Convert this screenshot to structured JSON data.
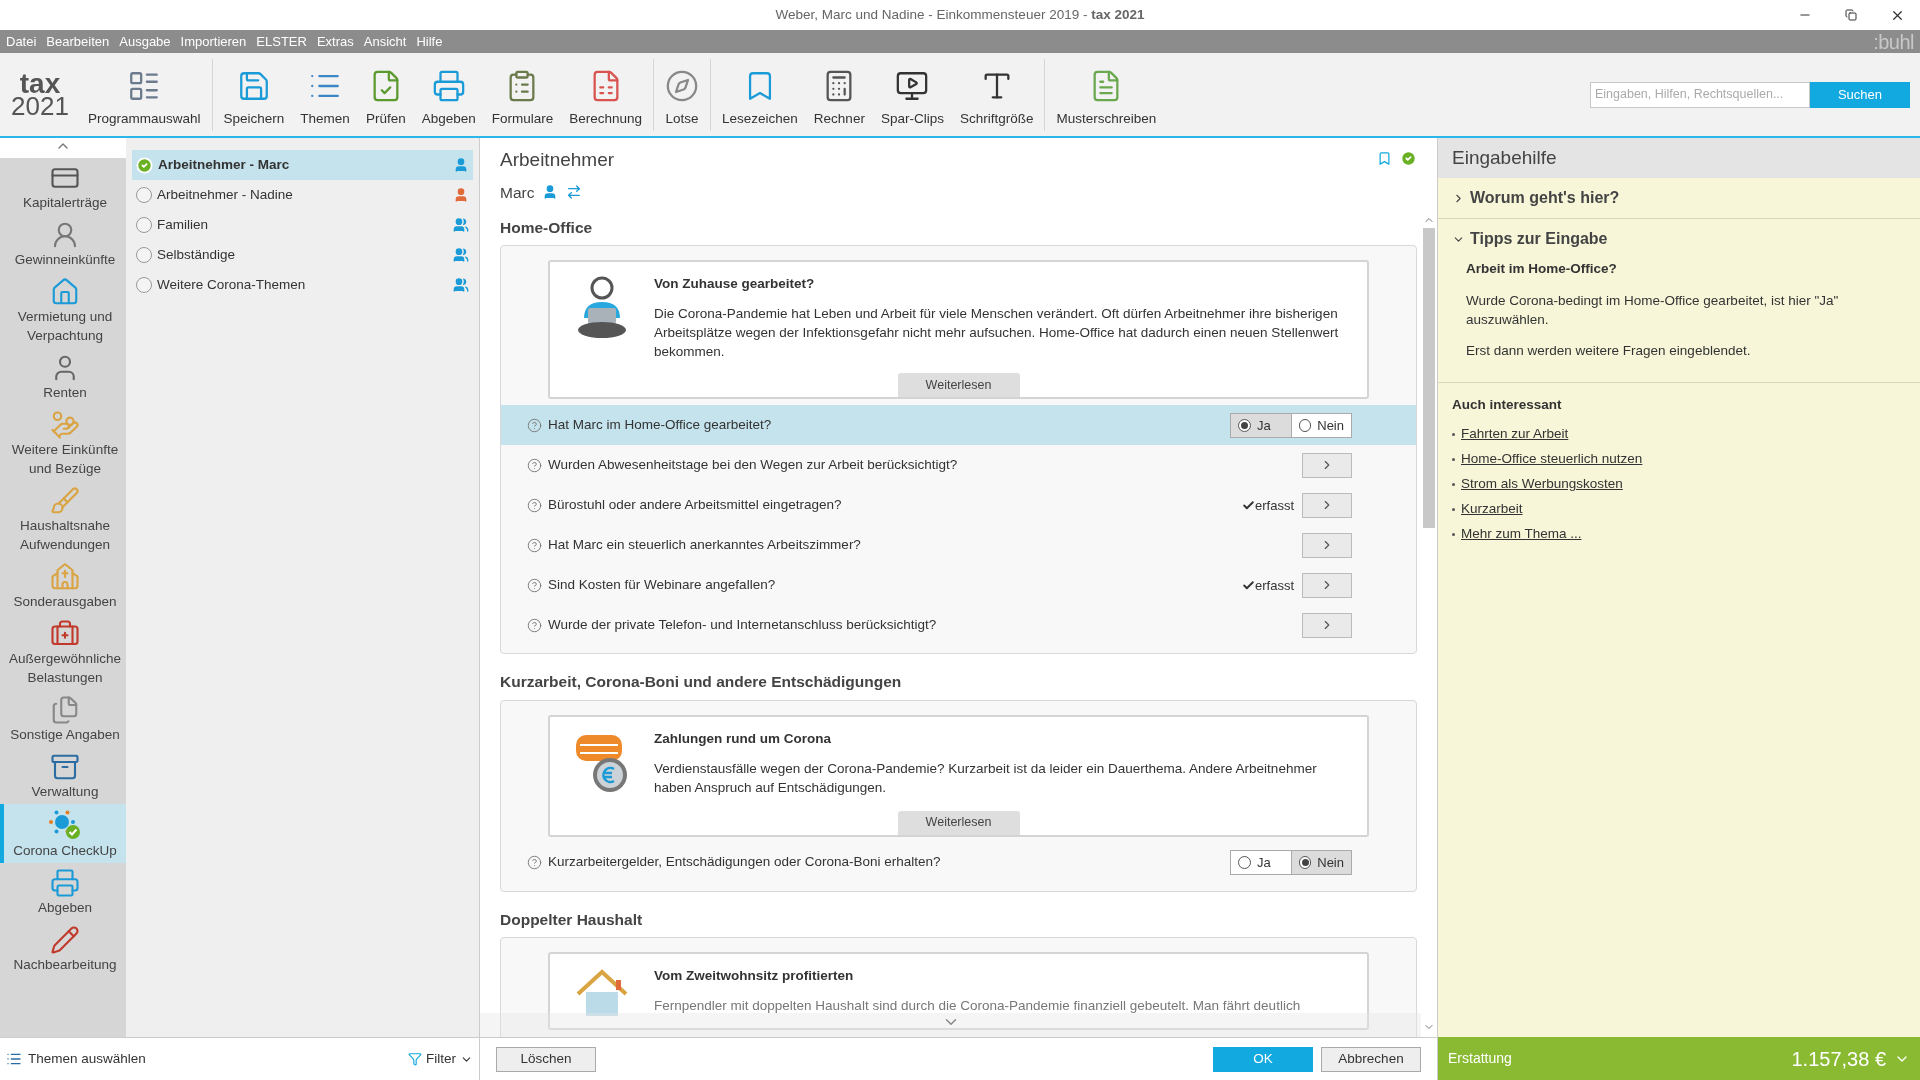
{
  "window": {
    "title": "Weber, Marc und Nadine - Einkommensteuer 2019 - **tax 2021**"
  },
  "menu": [
    {
      "label": "Datei"
    },
    {
      "label": "Bearbeiten"
    },
    {
      "label": "Ausgabe"
    },
    {
      "label": "Importieren"
    },
    {
      "label": "ELSTER"
    },
    {
      "label": "Extras"
    },
    {
      "label": "Ansicht"
    },
    {
      "label": "Hilfe"
    }
  ],
  "brand": ":buhl",
  "logo": {
    "line1": "tax",
    "line2": "2021"
  },
  "toolbar": [
    {
      "items": [
        "Programmauswahl"
      ]
    },
    {
      "items": [
        "Speichern",
        "Themen",
        "Prüfen",
        "Abgeben",
        "Formulare",
        "Berechnung"
      ]
    },
    {
      "items": [
        "Lotse"
      ]
    },
    {
      "items": [
        "Lesezeichen",
        "Rechner",
        "Spar-Clips",
        "Schriftgröße"
      ]
    },
    {
      "items": [
        "Musterschreiben"
      ]
    }
  ],
  "search": {
    "placeholder": "Eingaben, Hilfen, Rechtsquellen...",
    "button": "Suchen"
  },
  "nav": [
    {
      "label": "Kapitalerträge",
      "selected": false
    },
    {
      "label": "Gewinneinkünfte",
      "selected": false
    },
    {
      "label": "Vermietung und Verpachtung",
      "selected": false
    },
    {
      "label": "Renten",
      "selected": false
    },
    {
      "label": "Weitere Einkünfte und Bezüge",
      "selected": false
    },
    {
      "label": "Haushaltsnahe Aufwendungen",
      "selected": false
    },
    {
      "label": "Sonderausgaben",
      "selected": false
    },
    {
      "label": "Außergewöhnliche Belastungen",
      "selected": false
    },
    {
      "label": "Sonstige Angaben",
      "selected": false
    },
    {
      "label": "Verwaltung",
      "selected": false
    },
    {
      "label": "Corona CheckUp",
      "selected": true
    },
    {
      "label": "Abgeben",
      "selected": false
    },
    {
      "label": "Nachbearbeitung",
      "selected": false
    }
  ],
  "topics": [
    {
      "label": "Arbeitnehmer - Marc",
      "selected": true,
      "done": true,
      "kind": "husband"
    },
    {
      "label": "Arbeitnehmer - Nadine",
      "selected": false,
      "done": false,
      "kind": "wife"
    },
    {
      "label": "Familien",
      "selected": false,
      "done": false,
      "kind": "couple"
    },
    {
      "label": "Selbständige",
      "selected": false,
      "done": false,
      "kind": "couple"
    },
    {
      "label": "Weitere Corona-Themen",
      "selected": false,
      "done": false,
      "kind": "couple"
    }
  ],
  "page": {
    "title": "Arbeitnehmer",
    "person": "Marc",
    "done": true
  },
  "sections": [
    {
      "title": "Home-Office",
      "info": {
        "kind": "homeoffice",
        "title": "Von Zuhause gearbeitet?",
        "text": "Die Corona-Pandemie hat Leben und Arbeit für viele Menschen verändert. Oft dürfen Arbeitnehmer ihre bisherigen Arbeitsplätze wegen der Infektionsgefahr nicht mehr aufsuchen. Home-Office hat dadurch einen neuen Stellenwert bekommen.",
        "button": "Weiterlesen"
      },
      "questions": [
        {
          "kind": "yesno",
          "text": "Hat Marc im Home-Office gearbeitet?",
          "highlighted": true,
          "options": [
            {
              "label": "Ja",
              "selected": true
            },
            {
              "label": "Nein",
              "selected": false
            }
          ]
        },
        {
          "kind": "link",
          "text": "Wurden Abwesenheitstage bei den Wegen zur Arbeit berücksichtigt?",
          "highlighted": false,
          "done": false
        },
        {
          "kind": "link",
          "text": "Bürostuhl oder andere Arbeitsmittel eingetragen?",
          "highlighted": false,
          "done": true,
          "status": "erfasst"
        },
        {
          "kind": "link",
          "text": "Hat Marc ein steuerlich anerkanntes Arbeitszimmer?",
          "highlighted": false,
          "done": false
        },
        {
          "kind": "link",
          "text": "Sind Kosten für Webinare angefallen?",
          "highlighted": false,
          "done": true,
          "status": "erfasst"
        },
        {
          "kind": "link",
          "text": "Wurde der private Telefon- und Internetanschluss berücksichtigt?",
          "highlighted": false,
          "done": false
        }
      ]
    },
    {
      "title": "Kurzarbeit, Corona-Boni und andere Entschädigungen",
      "info": {
        "kind": "payments",
        "title": "Zahlungen rund um Corona",
        "text": "Verdienstausfälle wegen der Corona-Pandemie? Kurzarbeit ist da leider ein Dauerthema. Andere Arbeitnehmer haben Anspruch auf Entschädigungen.",
        "button": "Weiterlesen"
      },
      "questions": [
        {
          "kind": "yesno",
          "text": "Kurzarbeitergelder, Entschädigungen oder Corona-Boni erhalten?",
          "highlighted": false,
          "options": [
            {
              "label": "Ja",
              "selected": false
            },
            {
              "label": "Nein",
              "selected": true
            }
          ]
        }
      ]
    },
    {
      "title": "Doppelter Haushalt",
      "info": {
        "kind": "house",
        "title": "Vom Zweitwohnsitz profitierten",
        "text": "Fernpendler mit doppelten Haushalt sind durch die Corona-Pandemie finanziell gebeutelt. Man fährt deutlich"
      }
    }
  ],
  "footer": {
    "themes": "Themen auswählen",
    "filter": "Filter",
    "delete": "Löschen",
    "ok": "OK",
    "cancel": "Abbrechen"
  },
  "help": {
    "title": "Eingabehilfe",
    "sections": [
      {
        "title": "Worum geht's hier?",
        "expanded": false
      },
      {
        "title": "Tipps zur Eingabe",
        "expanded": true,
        "heading": "Arbeit im Home-Office?",
        "paragraphs": [
          "Wurde Corona-bedingt im Home-Office gearbeitet, ist hier \"Ja\" auszuwählen.",
          "Erst dann werden weitere Fragen eingeblendet."
        ]
      }
    ],
    "related_title": "Auch interessant",
    "links": [
      "Fahrten zur Arbeit",
      "Home-Office steuerlich nutzen",
      "Strom als Werbungskosten",
      "Kurzarbeit",
      "Mehr zum Thema ..."
    ]
  },
  "refund": {
    "label": "Erstattung",
    "amount": "1.157,38 €"
  }
}
